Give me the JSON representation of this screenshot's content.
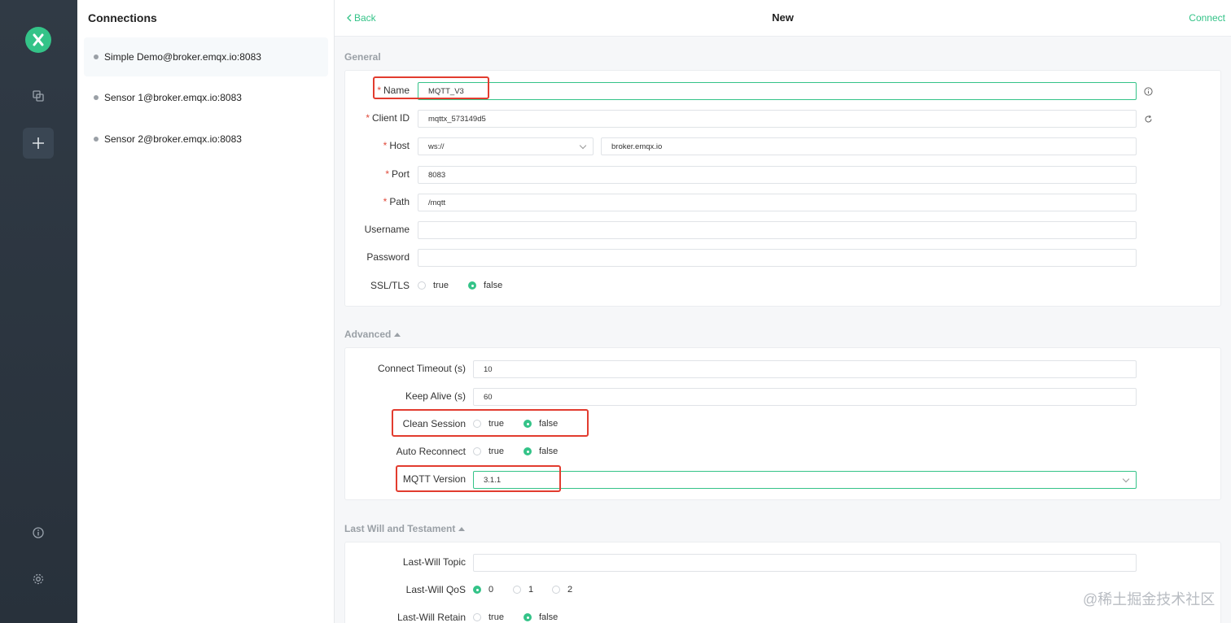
{
  "connections": {
    "title": "Connections",
    "items": [
      {
        "label": "Simple Demo@broker.emqx.io:8083"
      },
      {
        "label": "Sensor 1@broker.emqx.io:8083"
      },
      {
        "label": "Sensor 2@broker.emqx.io:8083"
      }
    ]
  },
  "header": {
    "back": "Back",
    "title": "New",
    "connect": "Connect"
  },
  "general": {
    "title": "General",
    "name": {
      "label": "Name",
      "value": "MQTT_V3"
    },
    "client_id": {
      "label": "Client ID",
      "value": "mqttx_573149d5"
    },
    "host": {
      "label": "Host",
      "protocol": "ws://",
      "value": "broker.emqx.io"
    },
    "port": {
      "label": "Port",
      "value": "8083"
    },
    "path": {
      "label": "Path",
      "value": "/mqtt"
    },
    "username": {
      "label": "Username",
      "value": ""
    },
    "password": {
      "label": "Password",
      "value": ""
    },
    "ssl": {
      "label": "SSL/TLS",
      "opt_true": "true",
      "opt_false": "false",
      "selected": "false"
    }
  },
  "advanced": {
    "title": "Advanced",
    "connect_timeout": {
      "label": "Connect Timeout (s)",
      "value": "10"
    },
    "keep_alive": {
      "label": "Keep Alive (s)",
      "value": "60"
    },
    "clean_session": {
      "label": "Clean Session",
      "opt_true": "true",
      "opt_false": "false",
      "selected": "false"
    },
    "auto_reconnect": {
      "label": "Auto Reconnect",
      "opt_true": "true",
      "opt_false": "false",
      "selected": "false"
    },
    "mqtt_version": {
      "label": "MQTT Version",
      "value": "3.1.1"
    }
  },
  "lwt": {
    "title": "Last Will and Testament",
    "topic": {
      "label": "Last-Will Topic",
      "value": ""
    },
    "qos": {
      "label": "Last-Will QoS",
      "options": [
        "0",
        "1",
        "2"
      ],
      "selected": "0"
    },
    "retain": {
      "label": "Last-Will Retain",
      "opt_true": "true",
      "opt_false": "false",
      "selected": "false"
    }
  },
  "watermark": "@稀土掘金技术社区",
  "colors": {
    "accent": "#34c388",
    "highlight": "#e23c2f",
    "sidebar": "#2c3540"
  }
}
